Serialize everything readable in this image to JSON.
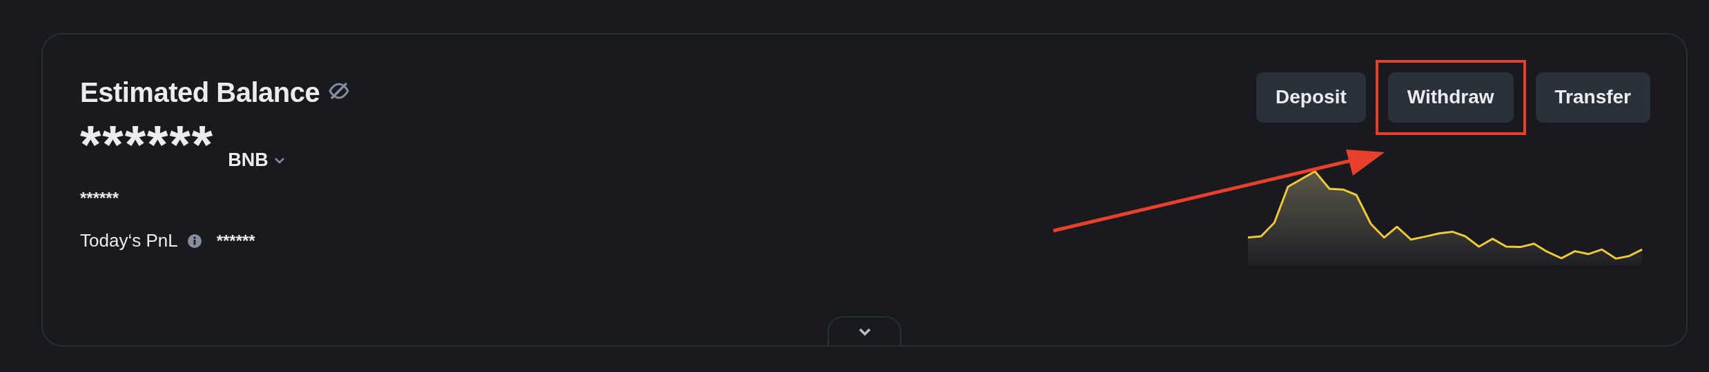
{
  "balance_card": {
    "title": "Estimated Balance",
    "hidden": true,
    "amount": "******",
    "currency": "BNB",
    "secondary_amount": "******",
    "pnl": {
      "label": "Today‘s PnL",
      "value": "******"
    },
    "buttons": [
      {
        "label": "Deposit",
        "highlighted": false
      },
      {
        "label": "Withdraw",
        "highlighted": true
      },
      {
        "label": "Transfer",
        "highlighted": false
      }
    ],
    "expanded": false
  }
}
